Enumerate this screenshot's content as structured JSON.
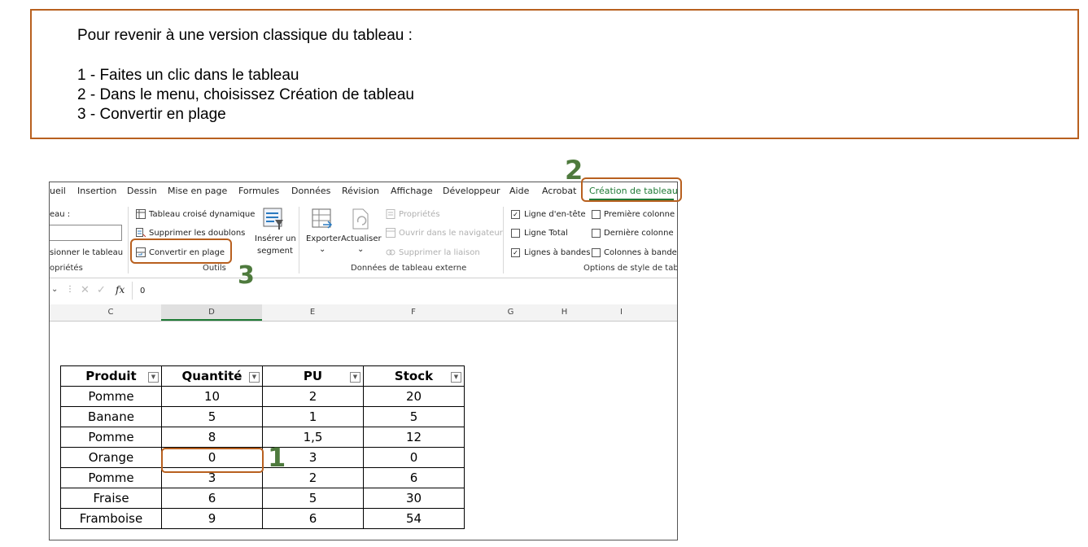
{
  "instructions": {
    "line1": "Pour revenir à une version classique du tableau :",
    "line2": "1 - Faites un clic dans le tableau",
    "line3": "2 - Dans le menu, choisissez Création de tableau",
    "line4": "3 - Convertir en plage"
  },
  "ribbon": {
    "tabs": [
      "ueil",
      "Insertion",
      "Dessin",
      "Mise en page",
      "Formules",
      "Données",
      "Révision",
      "Affichage",
      "Développeur",
      "Aide",
      "Acrobat",
      "Création de tableau"
    ],
    "properties": {
      "name_label": "eau :",
      "resize_label": "sionner le tableau",
      "group_label": "opriétés"
    },
    "tools": {
      "pivot": "Tableau croisé dynamique",
      "remove_dupes": "Supprimer les doublons",
      "convert": "Convertir en plage",
      "slicer_line1": "Insérer un",
      "slicer_line2": "segment",
      "group_label": "Outils"
    },
    "external": {
      "export": "Exporter",
      "refresh": "Actualiser",
      "properties": "Propriétés",
      "open_browser": "Ouvrir dans le navigateur",
      "unlink": "Supprimer la liaison",
      "group_label": "Données de tableau externe"
    },
    "style_options": {
      "header_row": "Ligne d'en-tête",
      "total_row": "Ligne Total",
      "banded_rows": "Lignes à bandes",
      "first_col": "Première colonne",
      "last_col": "Dernière colonne",
      "banded_cols": "Colonnes à bandes",
      "group_label": "Options de style de tablea"
    }
  },
  "formula_bar": {
    "fx": "fx",
    "value": "0"
  },
  "columns": [
    "C",
    "D",
    "E",
    "F",
    "G",
    "H",
    "I"
  ],
  "table": {
    "headers": [
      "Produit",
      "Quantité",
      "PU",
      "Stock"
    ],
    "rows": [
      [
        "Pomme",
        "10",
        "2",
        "20"
      ],
      [
        "Banane",
        "5",
        "1",
        "5"
      ],
      [
        "Pomme",
        "8",
        "1,5",
        "12"
      ],
      [
        "Orange",
        "0",
        "3",
        "0"
      ],
      [
        "Pomme",
        "3",
        "2",
        "6"
      ],
      [
        "Fraise",
        "6",
        "5",
        "30"
      ],
      [
        "Framboise",
        "9",
        "6",
        "54"
      ]
    ]
  },
  "badges": {
    "step1": "1",
    "step2": "2",
    "step3": "3"
  },
  "colors": {
    "highlight": "#b8601f",
    "badge": "#4e7a3d",
    "active_tab": "#1e7a35"
  }
}
